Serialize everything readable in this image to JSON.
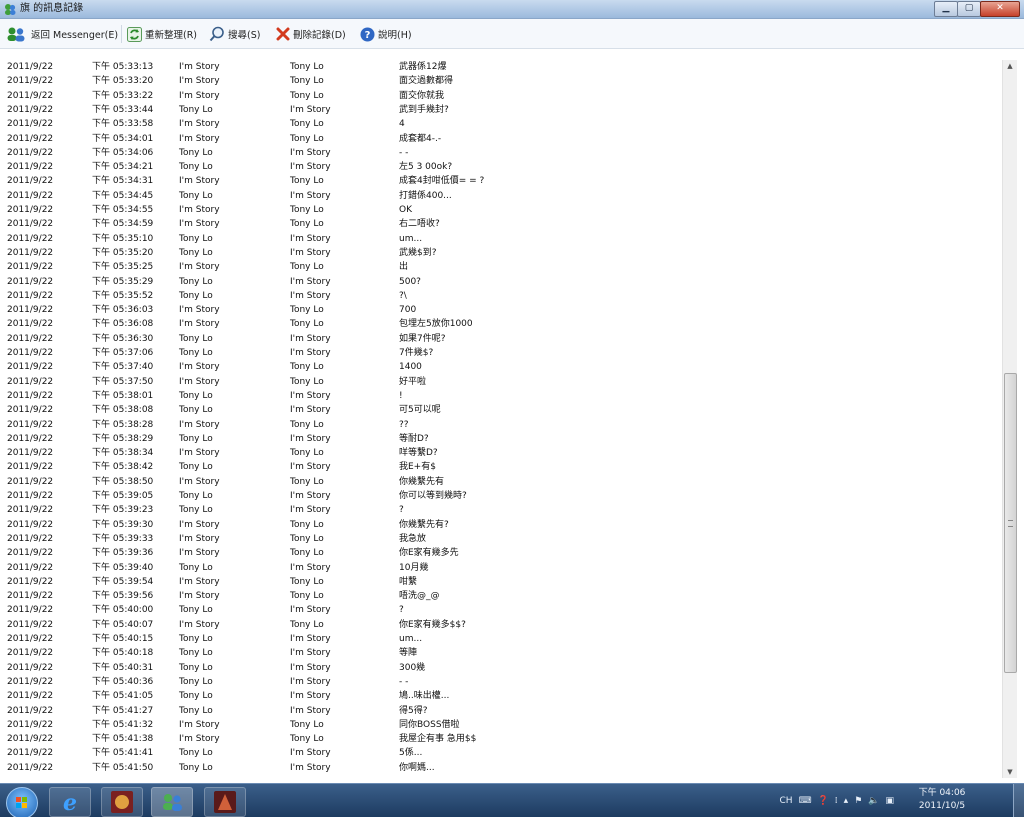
{
  "window": {
    "title": "旗 的訊息記錄"
  },
  "toolbar": {
    "back": "返回 Messenger(E)",
    "refresh": "重新整理(R)",
    "search": "搜尋(S)",
    "delete": "刪除記錄(D)",
    "help": "說明(H)"
  },
  "rows": [
    [
      "2011/9/22",
      "下午 05:33:13",
      "I'm Story",
      "Tony Lo",
      "武器係12爆"
    ],
    [
      "2011/9/22",
      "下午 05:33:20",
      "I'm Story",
      "Tony Lo",
      "面交過數都得"
    ],
    [
      "2011/9/22",
      "下午 05:33:22",
      "I'm Story",
      "Tony Lo",
      "面交你就我"
    ],
    [
      "2011/9/22",
      "下午 05:33:44",
      "Tony Lo",
      "I'm Story",
      "武到手幾封?"
    ],
    [
      "2011/9/22",
      "下午 05:33:58",
      "I'm Story",
      "Tony Lo",
      "4"
    ],
    [
      "2011/9/22",
      "下午 05:34:01",
      "I'm Story",
      "Tony Lo",
      "成套都4-.-"
    ],
    [
      "2011/9/22",
      "下午 05:34:06",
      "Tony Lo",
      "I'm Story",
      "- -"
    ],
    [
      "2011/9/22",
      "下午 05:34:21",
      "Tony Lo",
      "I'm Story",
      "左5 3 00ok?"
    ],
    [
      "2011/9/22",
      "下午 05:34:31",
      "I'm Story",
      "Tony Lo",
      "成套4封咁低價= = ?"
    ],
    [
      "2011/9/22",
      "下午 05:34:45",
      "Tony Lo",
      "I'm Story",
      "打錯係400..."
    ],
    [
      "2011/9/22",
      "下午 05:34:55",
      "I'm Story",
      "Tony Lo",
      "OK"
    ],
    [
      "2011/9/22",
      "下午 05:34:59",
      "I'm Story",
      "Tony Lo",
      "右二唔收?"
    ],
    [
      "2011/9/22",
      "下午 05:35:10",
      "Tony Lo",
      "I'm Story",
      "um..."
    ],
    [
      "2011/9/22",
      "下午 05:35:20",
      "Tony Lo",
      "I'm Story",
      "武幾$到?"
    ],
    [
      "2011/9/22",
      "下午 05:35:25",
      "I'm Story",
      "Tony Lo",
      "出"
    ],
    [
      "2011/9/22",
      "下午 05:35:29",
      "Tony Lo",
      "I'm Story",
      "500?"
    ],
    [
      "2011/9/22",
      "下午 05:35:52",
      "Tony Lo",
      "I'm Story",
      "?\\"
    ],
    [
      "2011/9/22",
      "下午 05:36:03",
      "I'm Story",
      "Tony Lo",
      "700"
    ],
    [
      "2011/9/22",
      "下午 05:36:08",
      "I'm Story",
      "Tony Lo",
      "包埋左5放你1000"
    ],
    [
      "2011/9/22",
      "下午 05:36:30",
      "Tony Lo",
      "I'm Story",
      "如果7件呢?"
    ],
    [
      "2011/9/22",
      "下午 05:37:06",
      "Tony Lo",
      "I'm Story",
      "7件幾$?"
    ],
    [
      "2011/9/22",
      "下午 05:37:40",
      "I'm Story",
      "Tony Lo",
      "1400"
    ],
    [
      "2011/9/22",
      "下午 05:37:50",
      "I'm Story",
      "Tony Lo",
      "好平啦"
    ],
    [
      "2011/9/22",
      "下午 05:38:01",
      "Tony Lo",
      "I'm Story",
      "!"
    ],
    [
      "2011/9/22",
      "下午 05:38:08",
      "Tony Lo",
      "I'm Story",
      "可5可以呢"
    ],
    [
      "2011/9/22",
      "下午 05:38:28",
      "I'm Story",
      "Tony Lo",
      "??"
    ],
    [
      "2011/9/22",
      "下午 05:38:29",
      "Tony Lo",
      "I'm Story",
      "等耐D?"
    ],
    [
      "2011/9/22",
      "下午 05:38:34",
      "I'm Story",
      "Tony Lo",
      "咩等繫D?"
    ],
    [
      "2011/9/22",
      "下午 05:38:42",
      "Tony Lo",
      "I'm Story",
      "我E+有$"
    ],
    [
      "2011/9/22",
      "下午 05:38:50",
      "I'm Story",
      "Tony Lo",
      "你幾繫先有"
    ],
    [
      "2011/9/22",
      "下午 05:39:05",
      "Tony Lo",
      "I'm Story",
      "你可以等到幾時?"
    ],
    [
      "2011/9/22",
      "下午 05:39:23",
      "Tony Lo",
      "I'm Story",
      "?"
    ],
    [
      "2011/9/22",
      "下午 05:39:30",
      "I'm Story",
      "Tony Lo",
      "你幾繫先有?"
    ],
    [
      "2011/9/22",
      "下午 05:39:33",
      "I'm Story",
      "Tony Lo",
      "我急放"
    ],
    [
      "2011/9/22",
      "下午 05:39:36",
      "I'm Story",
      "Tony Lo",
      "你E家有幾多先"
    ],
    [
      "2011/9/22",
      "下午 05:39:40",
      "Tony Lo",
      "I'm Story",
      "10月幾"
    ],
    [
      "2011/9/22",
      "下午 05:39:54",
      "I'm Story",
      "Tony Lo",
      "咁繫"
    ],
    [
      "2011/9/22",
      "下午 05:39:56",
      "I'm Story",
      "Tony Lo",
      "唔洗@_@"
    ],
    [
      "2011/9/22",
      "下午 05:40:00",
      "Tony Lo",
      "I'm Story",
      "?"
    ],
    [
      "2011/9/22",
      "下午 05:40:07",
      "I'm Story",
      "Tony Lo",
      "你E家有幾多$$?"
    ],
    [
      "2011/9/22",
      "下午 05:40:15",
      "Tony Lo",
      "I'm Story",
      "um..."
    ],
    [
      "2011/9/22",
      "下午 05:40:18",
      "Tony Lo",
      "I'm Story",
      "等陣"
    ],
    [
      "2011/9/22",
      "下午 05:40:31",
      "Tony Lo",
      "I'm Story",
      "300幾"
    ],
    [
      "2011/9/22",
      "下午 05:40:36",
      "Tony Lo",
      "I'm Story",
      "- -"
    ],
    [
      "2011/9/22",
      "下午 05:41:05",
      "Tony Lo",
      "I'm Story",
      "鳩..味出權..."
    ],
    [
      "2011/9/22",
      "下午 05:41:27",
      "Tony Lo",
      "I'm Story",
      "得5得?"
    ],
    [
      "2011/9/22",
      "下午 05:41:32",
      "I'm Story",
      "Tony Lo",
      "同你BOSS借啦"
    ],
    [
      "2011/9/22",
      "下午 05:41:38",
      "I'm Story",
      "Tony Lo",
      "我屋企有事 急用$$"
    ],
    [
      "2011/9/22",
      "下午 05:41:41",
      "Tony Lo",
      "I'm Story",
      "5係..."
    ],
    [
      "2011/9/22",
      "下午 05:41:50",
      "Tony Lo",
      "I'm Story",
      "你啊媽..."
    ]
  ],
  "taskbar": {
    "tray_lang": "CH",
    "clock_time": "下午 04:06",
    "clock_date": "2011/10/5"
  },
  "scrollbar": {
    "position_fraction": 0.44,
    "visible_fraction": 0.42
  }
}
